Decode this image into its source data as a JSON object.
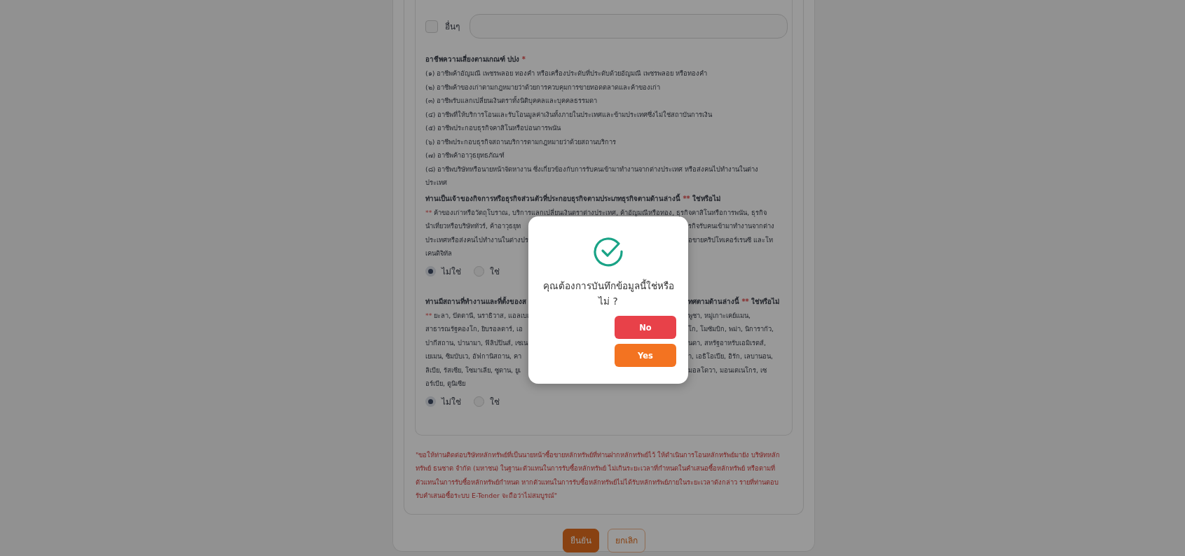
{
  "other_option": {
    "label": "อื่นๆ",
    "checked": false
  },
  "risk_occupations": {
    "heading": {
      "left": [
        {
          "text": "อาชีพความเสี่ยงตามเกณฑ์ ปปง",
          "kind": "text"
        },
        {
          "text": "*",
          "kind": "flag"
        }
      ]
    },
    "items": [
      "(๑) อาชีพค้าอัญมณี เพชรพลอย ทองคำ หรือเครื่องประดับที่ประดับด้วยอัญมณี เพชรพลอย หรือทองคำ",
      "(๒) อาชีพค้าของเก่าตามกฎหมายว่าด้วยการควบคุมการขายทอดตลาดและค้าของเก่า",
      "(๓) อาชีพรับแลกเปลี่ยนเงินตราทั้งนิติบุคคลและบุคคลธรรมดา",
      "(๔) อาชีพที่ให้บริการโอนและรับโอนมูลค่าเงินทั้งภายในประเทศและข้ามประเทศซึ่งไม่ใช่สถาบันการเงิน",
      "(๕) อาชีพประกอบธุรกิจคาสิโนหรือบ่อนการพนัน",
      "(๖) อาชีพประกอบธุรกิจสถานบริการตามกฎหมายว่าด้วยสถานบริการ",
      "(๗) อาชีพค้าอาวุธยุทธภัณฑ์",
      "(๘) อาชีพบริษัทหรือนายหน้าจัดหางาน ซึ่งเกี่ยวข้องกับการรับคนเข้ามาทำงานจากต่างประเทศ หรือส่งคนไปทำงานในต่างประเทศ"
    ]
  },
  "questions": [
    {
      "heading": {
        "left": [
          {
            "text": "ท่านเป็นเจ้าของกิจการหรือธุรกิจส่วนตัวที่ประกอบธุรกิจตามประเภทธุรกิจตามด้านล่างนี้",
            "kind": "text"
          },
          {
            "text": "**",
            "kind": "flag"
          },
          {
            "text": "ใช่หรือไม่",
            "kind": "text"
          }
        ]
      },
      "note_lines": [
        {
          "left": [
            {
              "text": "**",
              "kind": "flag"
            },
            {
              "text": "ค้าของเก่าหรือวัตถุโบราณ, บริการแลกเปลี่ยนเงินตราต่างประเทศ, ค้าอัญมณีหรือทอง, ธุรกิจคาสิโนหรือการพนัน, ธุรกิจ",
              "kind": "text"
            }
          ]
        },
        {
          "left": [
            {
              "text": "นำเที่ยวหรือบริษัททัวร์, ค้าอาวุธยุท",
              "kind": "text"
            }
          ],
          "right": [
            {
              "text": "รกิจรับคนเข้ามาทำงานจากต่าง",
              "kind": "text"
            }
          ]
        },
        {
          "left": [
            {
              "text": "ประเทศหรือส่งคนไปทำงานในต่างปร",
              "kind": "text"
            }
          ],
          "right": [
            {
              "text": "อขายคริปโทเคอร์เรนซี และโท",
              "kind": "text"
            }
          ]
        },
        {
          "left": [
            {
              "text": "เคนดิจิทัล",
              "kind": "text"
            }
          ]
        }
      ],
      "options": [
        {
          "label": "ไม่ใช่",
          "selected": true
        },
        {
          "label": "ใช่",
          "selected": false
        }
      ]
    },
    {
      "heading": {
        "left": [
          {
            "text": "ท่านมีสถานที่ทำงานและที่ตั้งของส",
            "kind": "text"
          }
        ],
        "right": [
          {
            "text": "ทศตามด้านล่างนี้",
            "kind": "text"
          },
          {
            "text": "**",
            "kind": "flag"
          },
          {
            "text": "ใช่หรือไม่",
            "kind": "text"
          }
        ]
      },
      "note_lines": [
        {
          "left": [
            {
              "text": "**",
              "kind": "flag"
            },
            {
              "text": "ยะลา, ปัตตานี, นราธิวาส, แอลเบเ",
              "kind": "text"
            }
          ],
          "right": [
            {
              "text": "พูชา, หมู่เกาะเคย์แมน,",
              "kind": "text"
            }
          ]
        },
        {
          "left": [
            {
              "text": "สาธารณรัฐคองโก, ยิบรอลตาร์, เอ",
              "kind": "text"
            }
          ],
          "right": [
            {
              "text": "โก, โมซัมบิก, พม่า, นิการากัว,",
              "kind": "text"
            }
          ]
        },
        {
          "left": [
            {
              "text": "ปากีสถาน, ปานามา, ฟิลิปปินส์, เซเน",
              "kind": "text"
            }
          ],
          "right": [
            {
              "text": "นดา, สหรัฐอาหรับเอมิเรตส์,",
              "kind": "text"
            }
          ]
        },
        {
          "left": [
            {
              "text": "เยเมน, ซิมบับเว, อัฟกานิสถาน, คา",
              "kind": "text"
            }
          ],
          "right": [
            {
              "text": "า, เอธิโอเปีย, อิรัก, เลบานอน,",
              "kind": "text"
            }
          ]
        },
        {
          "left": [
            {
              "text": "ลิเบีย, รัสเซีย, โซมาเลีย, ซูดาน, ยูเ",
              "kind": "text"
            }
          ],
          "right": [
            {
              "text": "มอลโดวา, มอนเตเนโกร, เซ",
              "kind": "text"
            }
          ]
        },
        {
          "left": [
            {
              "text": "อร์เบีย, ตูนิเซีย",
              "kind": "text"
            }
          ]
        }
      ],
      "options": [
        {
          "label": "ไม่ใช่",
          "selected": true
        },
        {
          "label": "ใช่",
          "selected": false
        }
      ]
    }
  ],
  "notice": "\"ขอให้ท่านติดต่อบริษัทหลักทรัพย์ที่เป็นนายหน้าซื้อขายหลักทรัพย์ที่ท่านฝากหลักทรัพย์ไว้ ให้ดำเนินการโอนหลักทรัพย์มายัง บริษัทหลักทรัพย์ ธนชาต จำกัด (มหาชน) ในฐานะตัวแทนในการรับซื้อหลักทรัพย์ ไม่เกินระยะเวลาที่กำหนดในคำเสนอซื้อหลักทรัพย์ หรือตามที่ตัวแทนในการรับซื้อหลักทรัพย์กำหนด หากตัวแทนในการรับซื้อหลักทรัพย์ไม่ได้รับหลักทรัพย์ภายในระยะเวลาดังกล่าว รายที่ท่านตอบรับคำเสนอซื้อระบบ E-Tender จะถือว่าไม่สมบูรณ์\"",
  "actions": [
    {
      "label": "ยืนยัน",
      "kind": "primary"
    },
    {
      "label": "ยกเลิก",
      "kind": "outline"
    }
  ],
  "dialog": {
    "message": "คุณต้องการบันทึกข้อมูลนี้ใช่หรือไม่ ?",
    "buttons": [
      {
        "label": "No",
        "kind": "danger"
      },
      {
        "label": "Yes",
        "kind": "confirm"
      }
    ]
  }
}
